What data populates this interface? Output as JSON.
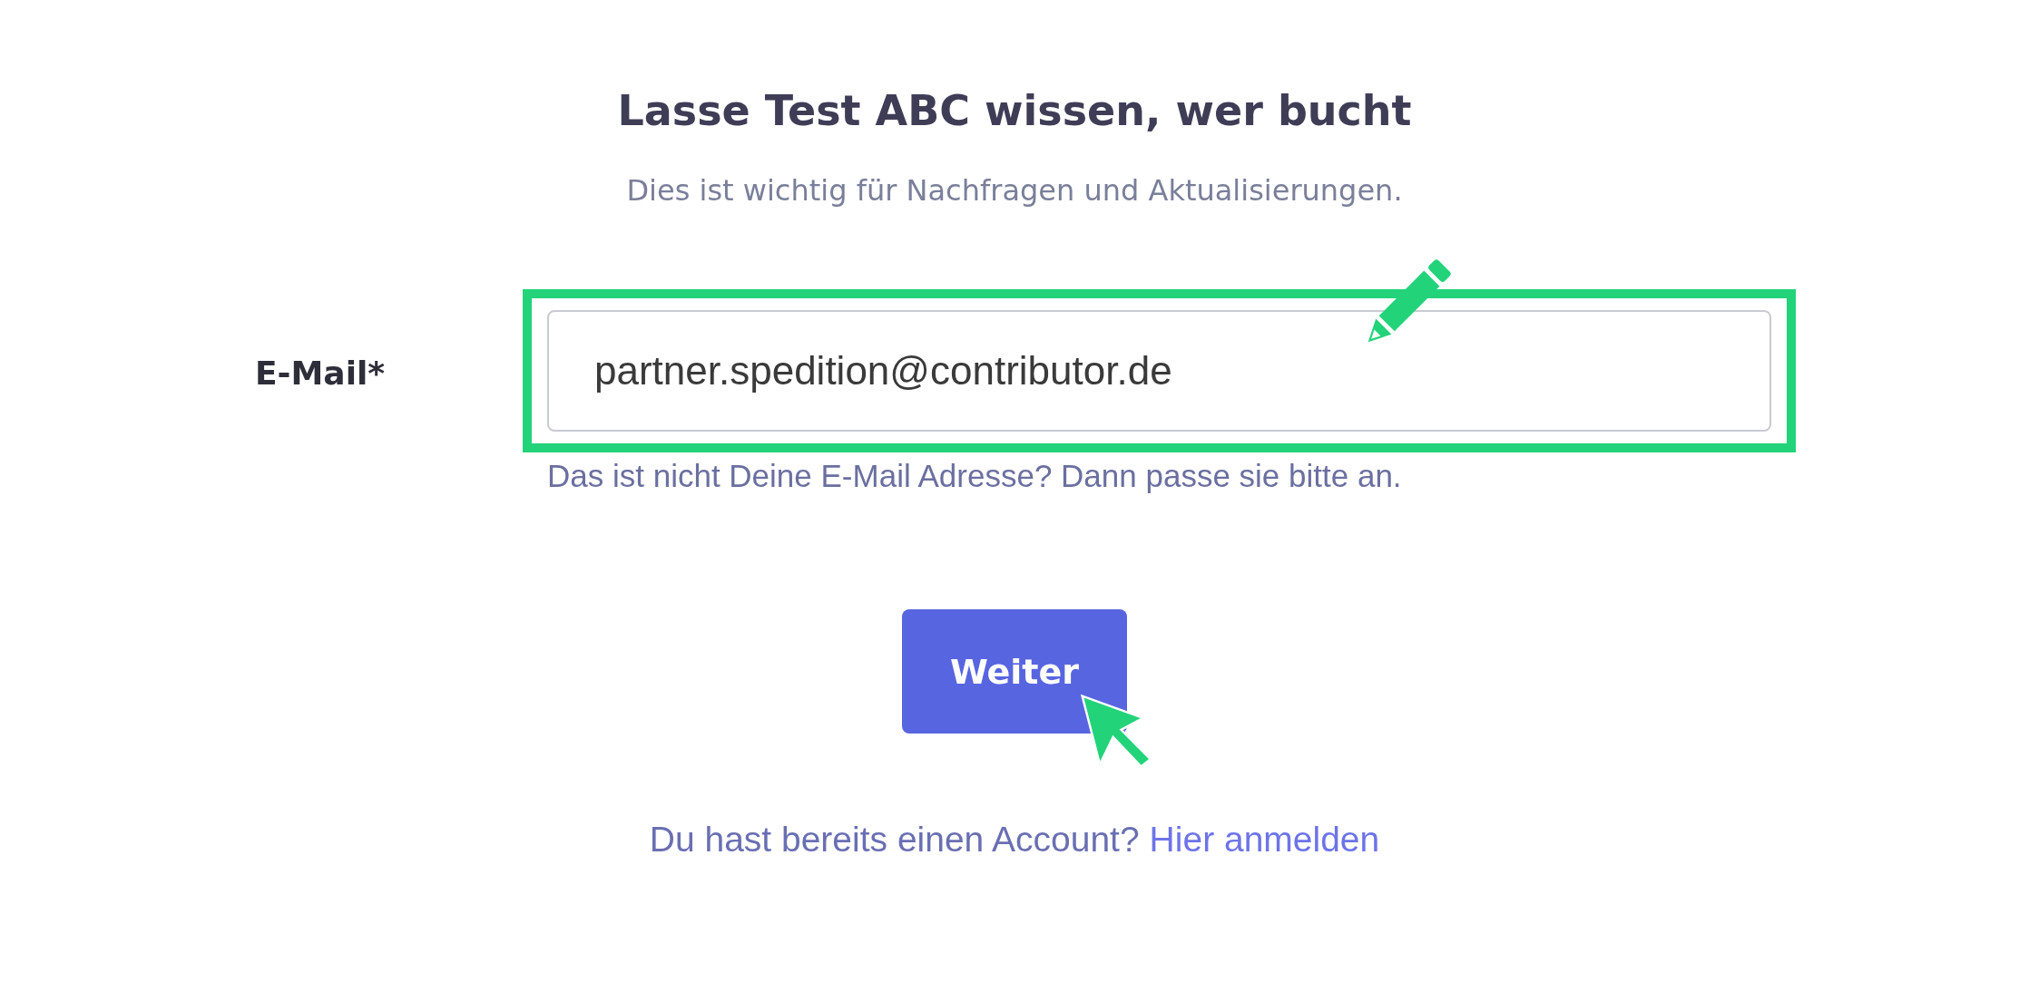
{
  "heading": {
    "title": "Lasse Test ABC wissen, wer bucht",
    "subtitle": "Dies ist wichtig für Nachfragen und Aktualisierungen."
  },
  "email_field": {
    "label": "E-Mail*",
    "value": "partner.spedition@contributor.de",
    "hint": "Das ist nicht Deine E-Mail Adresse? Dann passe sie bitte an.",
    "highlighted": true
  },
  "button": {
    "label": "Weiter"
  },
  "footer": {
    "text": "Du hast bereits einen Account?",
    "link": "Hier anmelden"
  }
}
